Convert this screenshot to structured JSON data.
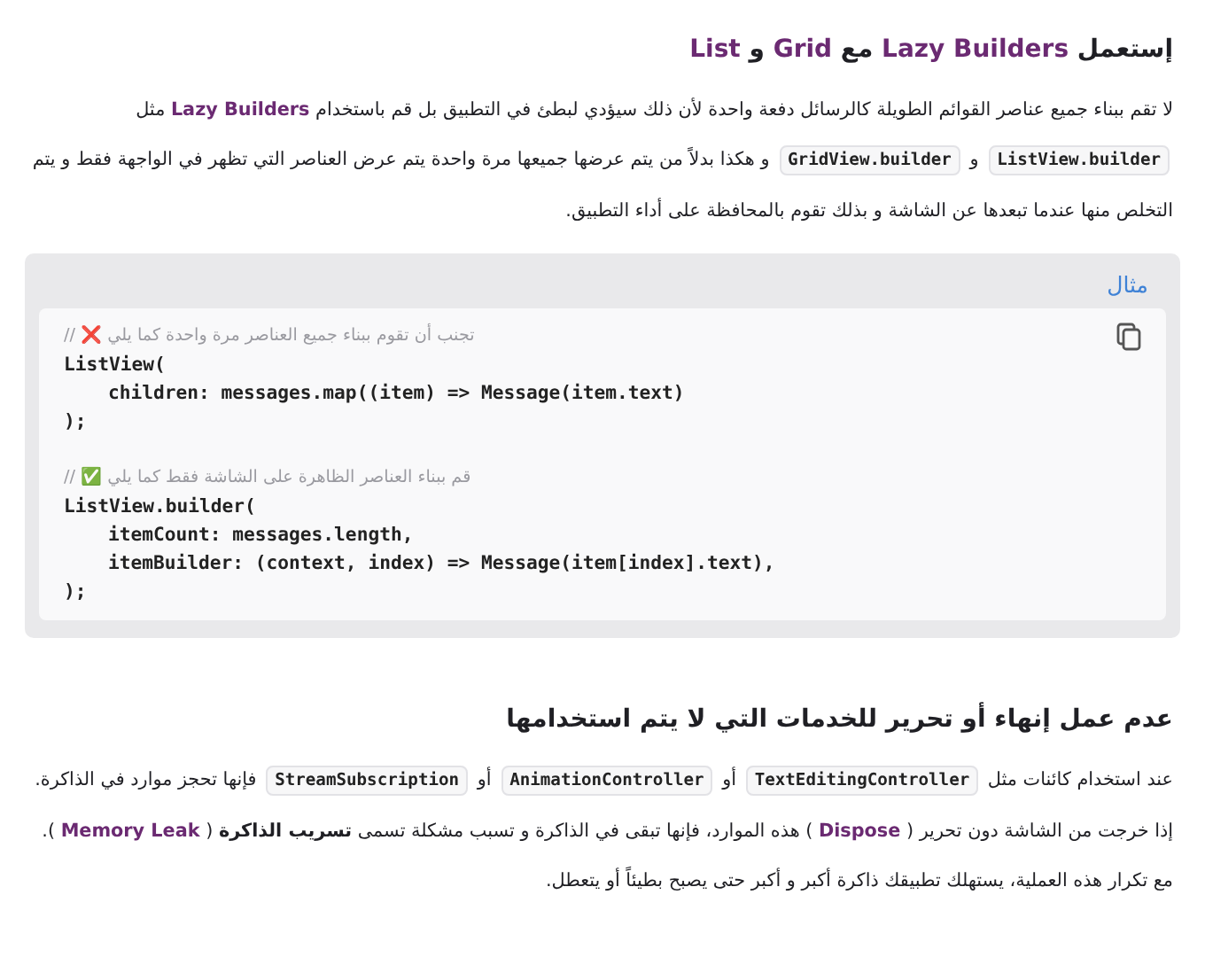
{
  "sections": [
    {
      "heading": [
        {
          "kind": "text",
          "text": "إستعمل "
        },
        {
          "kind": "term",
          "text": "Lazy Builders"
        },
        {
          "kind": "text",
          "text": " مع "
        },
        {
          "kind": "term",
          "text": "Grid"
        },
        {
          "kind": "text",
          "text": " و "
        },
        {
          "kind": "term",
          "text": "List"
        }
      ],
      "paragraphs": [
        [
          {
            "kind": "text",
            "text": "لا تقم ببناء جميع عناصر القوائم الطويلة كالرسائل دفعة واحدة لأن ذلك سيؤدي لبطئ في التطبيق بل قم باستخدام "
          },
          {
            "kind": "term",
            "text": "Lazy Builders"
          },
          {
            "kind": "text",
            "text": " مثل "
          },
          {
            "kind": "code",
            "text": "ListView.builder"
          },
          {
            "kind": "text",
            "text": " و "
          },
          {
            "kind": "code",
            "text": "GridView.builder"
          },
          {
            "kind": "text",
            "text": " و هكذا بدلاً من يتم عرضها جميعها مرة واحدة يتم عرض العناصر التي تظهر في الواجهة فقط و يتم التخلص منها عندما تبعدها عن الشاشة و بذلك تقوم بالمحافظة على أداء التطبيق."
          }
        ]
      ],
      "example": {
        "title": "مثال",
        "lines": [
          {
            "kind": "comment",
            "text": "// ❌ تجنب أن تقوم ببناء جميع العناصر مرة واحدة كما يلي"
          },
          {
            "kind": "code",
            "text": "ListView("
          },
          {
            "kind": "indented",
            "text": "children: messages.map((item) => Message(item.text)"
          },
          {
            "kind": "code",
            "text": ");"
          },
          {
            "kind": "blank"
          },
          {
            "kind": "comment",
            "text": "// ✅ قم ببناء العناصر الظاهرة على الشاشة فقط كما يلي"
          },
          {
            "kind": "code",
            "text": "ListView.builder("
          },
          {
            "kind": "indented",
            "text": "itemCount: messages.length,"
          },
          {
            "kind": "indented",
            "text": "itemBuilder: (context, index) => Message(item[index].text),"
          },
          {
            "kind": "code",
            "text": ");"
          }
        ]
      }
    },
    {
      "heading": [
        {
          "kind": "text",
          "text": "عدم عمل إنهاء أو تحرير للخدمات التي لا يتم استخدامها"
        }
      ],
      "paragraphs": [
        [
          {
            "kind": "text",
            "text": "عند استخدام كائنات مثل "
          },
          {
            "kind": "code",
            "text": "TextEditingController"
          },
          {
            "kind": "text",
            "text": " أو "
          },
          {
            "kind": "code",
            "text": "AnimationController"
          },
          {
            "kind": "text",
            "text": " أو "
          },
          {
            "kind": "code",
            "text": "StreamSubscription"
          },
          {
            "kind": "text",
            "text": " فإنها تحجز موارد في الذاكرة."
          }
        ],
        [
          {
            "kind": "text",
            "text": "إذا خرجت من الشاشة دون تحرير ( "
          },
          {
            "kind": "term",
            "text": "Dispose"
          },
          {
            "kind": "text",
            "text": " ) هذه الموارد، فإنها تبقى في الذاكرة و تسبب مشكلة تسمى "
          },
          {
            "kind": "bold",
            "text": "تسريب الذاكرة"
          },
          {
            "kind": "text",
            "text": " ( "
          },
          {
            "kind": "term",
            "text": "Memory Leak"
          },
          {
            "kind": "text",
            "text": " ). مع تكرار هذه العملية، يستهلك تطبيقك ذاكرة أكبر و أكبر حتى يصبح بطيئاً أو يتعطل."
          }
        ]
      ]
    }
  ]
}
